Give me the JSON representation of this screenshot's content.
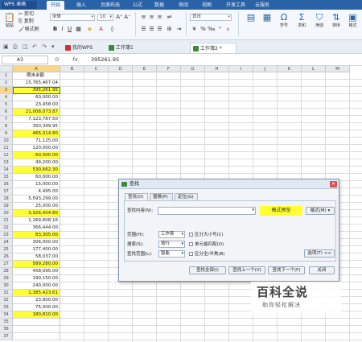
{
  "menubar": {
    "app_label": "WPS 表格",
    "tabs": [
      "开始",
      "插入",
      "页面布局",
      "公式",
      "数据",
      "审阅",
      "视图",
      "开发工具",
      "云服务"
    ]
  },
  "toolbar": {
    "paste": "粘贴",
    "cut": "剪切",
    "copy": "复制",
    "format_painter": "格式刷",
    "font_name": "宋体",
    "font_size": "10",
    "number_format": "货币",
    "symbol": "符号",
    "sum": "求和",
    "filter": "筛选",
    "sort": "排序",
    "format": "格式"
  },
  "tabbar": {
    "tabs": [
      "我的WPS",
      "工作簿1",
      "工作簿2 *"
    ],
    "active_index": 2
  },
  "formula": {
    "cell_ref": "A3",
    "fx": "fx",
    "value": "395261.95"
  },
  "grid": {
    "columns": [
      "A",
      "B",
      "C",
      "D",
      "E",
      "F",
      "G",
      "H",
      "I",
      "J",
      "K",
      "L",
      "M"
    ],
    "row_numbers": [
      "1",
      "2",
      "3",
      "4",
      "5",
      "6",
      "7",
      "8",
      "9",
      "10",
      "11",
      "12",
      "13",
      "14",
      "15",
      "16",
      "17",
      "18",
      "19",
      "20",
      "21",
      "22",
      "23",
      "24",
      "25",
      "26",
      "27",
      "28",
      "29",
      "30",
      "31",
      "32",
      "33",
      "34",
      "35",
      "36",
      "37"
    ],
    "column_a": [
      {
        "text": "期末余额",
        "hl": false
      },
      {
        "text": "15,765,467.04",
        "hl": false
      },
      {
        "text": "395,261.95",
        "hl": true
      },
      {
        "text": "60,000.00",
        "hl": false
      },
      {
        "text": "23,458.00",
        "hl": false
      },
      {
        "text": "21,008,073.87",
        "hl": true
      },
      {
        "text": "7,123,787.50",
        "hl": false
      },
      {
        "text": "350,349.95",
        "hl": false
      },
      {
        "text": "465,314.80",
        "hl": true
      },
      {
        "text": "71,125.00",
        "hl": false
      },
      {
        "text": "120,000.00",
        "hl": false
      },
      {
        "text": "60,000.00",
        "hl": true
      },
      {
        "text": "49,200.00",
        "hl": false
      },
      {
        "text": "530,662.30",
        "hl": true
      },
      {
        "text": "60,000.00",
        "hl": false
      },
      {
        "text": "15,000.00",
        "hl": false
      },
      {
        "text": "4,495.00",
        "hl": false
      },
      {
        "text": "5,593,299.00",
        "hl": false
      },
      {
        "text": "25,000.00",
        "hl": false
      },
      {
        "text": "3,926,404.80",
        "hl": true
      },
      {
        "text": "1,269,808.16",
        "hl": false
      },
      {
        "text": "366,444.00",
        "hl": false
      },
      {
        "text": "83,305.00",
        "hl": true
      },
      {
        "text": "306,000.00",
        "hl": false
      },
      {
        "text": "177,400.00",
        "hl": false
      },
      {
        "text": "58,037.00",
        "hl": false
      },
      {
        "text": "589,280.00",
        "hl": true
      },
      {
        "text": "458,095.00",
        "hl": false
      },
      {
        "text": "190,150.00",
        "hl": false
      },
      {
        "text": "240,000.00",
        "hl": false
      },
      {
        "text": "1,385,423.61",
        "hl": true
      },
      {
        "text": "23,800.00",
        "hl": false
      },
      {
        "text": "75,000.00",
        "hl": false
      },
      {
        "text": "180,810.00",
        "hl": true
      },
      {
        "text": "",
        "hl": false
      },
      {
        "text": "",
        "hl": false
      },
      {
        "text": "",
        "hl": false
      }
    ]
  },
  "dialog": {
    "title": "查找",
    "tabs": [
      "查找(D)",
      "替换(P)",
      "定位(G)"
    ],
    "find_label": "查找内容(N):",
    "preview": "格式预览",
    "format_button": "格式(M) ▾",
    "scope_label": "范围(H):",
    "scope_value": "工作表",
    "search_label": "搜索(S):",
    "search_value": "按行",
    "lookin_label": "查找范围(L):",
    "lookin_value": "智能",
    "match_case": "区分大小写(C)",
    "match_cell": "单元格匹配(O)",
    "match_width": "区分全/半角(B)",
    "options_button": "选项(T) <<",
    "find_all": "查找全部(I)",
    "find_prev": "查找上一个(V)",
    "find_next": "查找下一个(F)",
    "close": "关闭"
  },
  "watermark": {
    "big": "百科全说",
    "small": "助你轻松解决"
  }
}
